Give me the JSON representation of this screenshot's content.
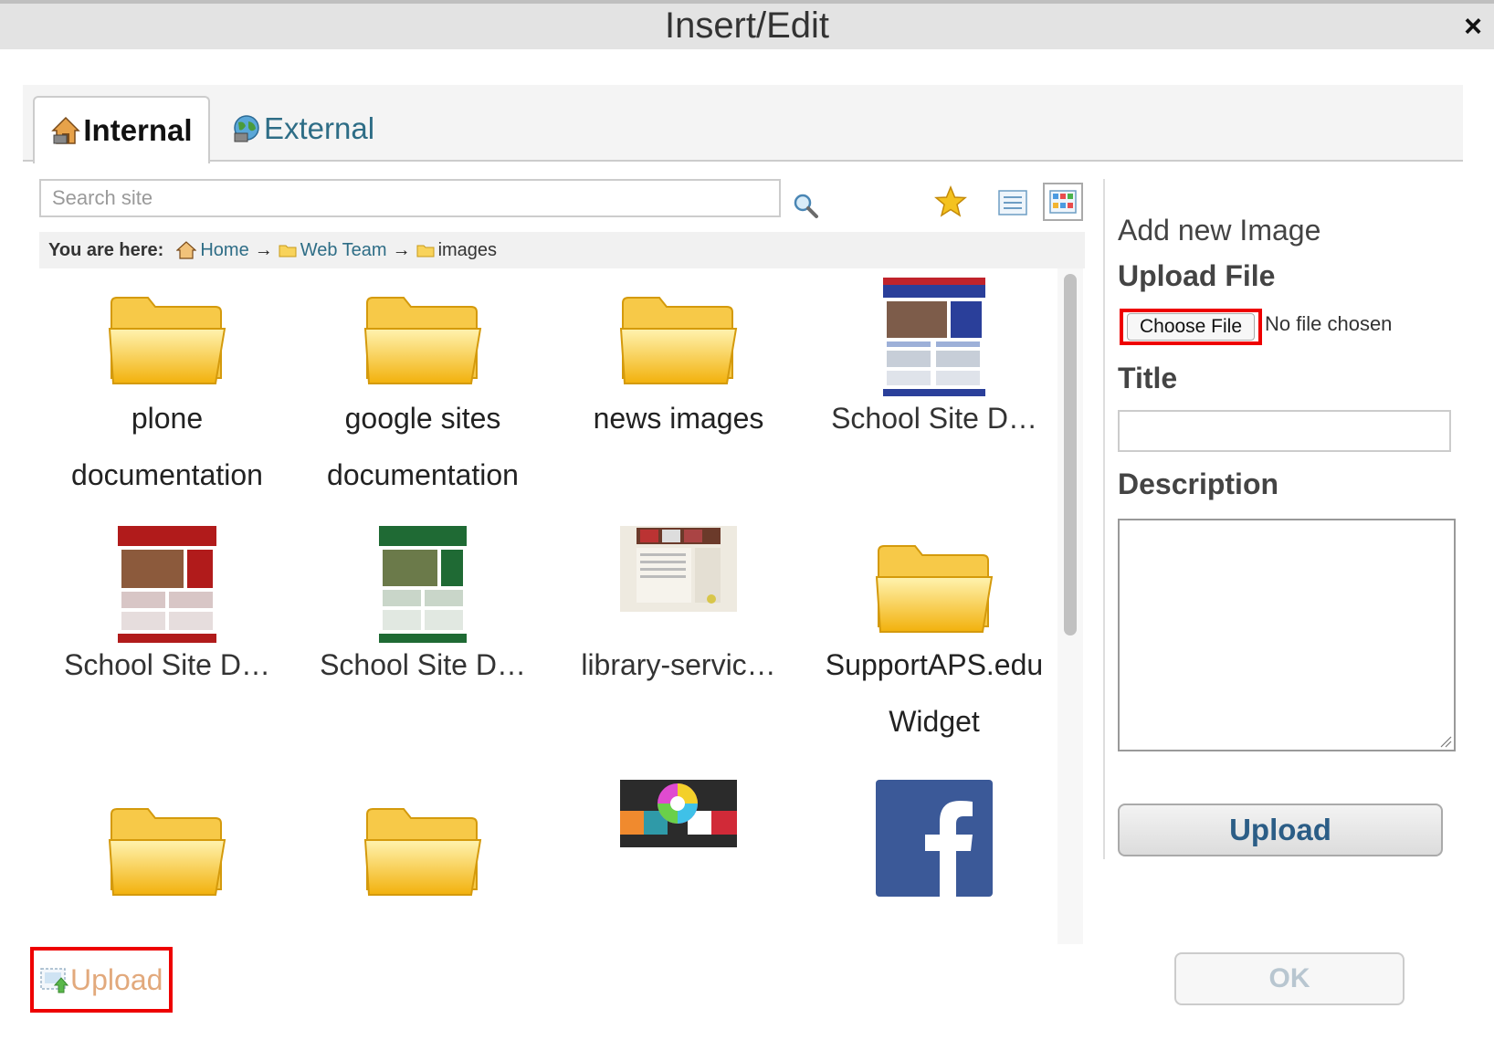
{
  "window": {
    "title": "Insert/Edit",
    "close_symbol": "×"
  },
  "tabs": [
    {
      "label": "Internal",
      "icon": "internal-house-icon",
      "active": true
    },
    {
      "label": "External",
      "icon": "external-globe-icon",
      "active": false
    }
  ],
  "search": {
    "placeholder": "Search site"
  },
  "toolbar": {
    "icons": [
      "search-icon",
      "star-icon",
      "list-view-icon",
      "thumbnail-view-icon"
    ]
  },
  "breadcrumb": {
    "prefix": "You are here:",
    "items": [
      "Home",
      "Web Team",
      "images"
    ],
    "separator": "→"
  },
  "items": [
    {
      "type": "folder",
      "line1": "plone",
      "line2": "documentation"
    },
    {
      "type": "folder",
      "line1": "google sites",
      "line2": "documentation"
    },
    {
      "type": "folder",
      "line1": "news images",
      "line2": ""
    },
    {
      "type": "image",
      "line1": "School Site D…",
      "line2": "",
      "thumb": "blue-site"
    },
    {
      "type": "image",
      "line1": "School Site D…",
      "line2": "",
      "thumb": "red-site"
    },
    {
      "type": "image",
      "line1": "School Site D…",
      "line2": "",
      "thumb": "green-site"
    },
    {
      "type": "image",
      "line1": "library-servic…",
      "line2": "",
      "thumb": "library"
    },
    {
      "type": "folder",
      "line1": "SupportAPS.edu",
      "line2": "Widget"
    },
    {
      "type": "folder",
      "line1": "",
      "line2": ""
    },
    {
      "type": "folder",
      "line1": "",
      "line2": ""
    },
    {
      "type": "image",
      "line1": "",
      "line2": "",
      "thumb": "color-wheel"
    },
    {
      "type": "image",
      "line1": "",
      "line2": "",
      "thumb": "facebook"
    }
  ],
  "panel": {
    "heading": "Add new Image",
    "upload_file_label": "Upload File",
    "choose_file_label": "Choose File",
    "no_file_text": "No file chosen",
    "title_label": "Title",
    "description_label": "Description",
    "upload_button": "Upload"
  },
  "footer": {
    "upload_link": "Upload",
    "ok_button": "OK"
  },
  "colors": {
    "link": "#2e6d86",
    "highlight": "#e00000",
    "upload_text": "#2b5d86"
  }
}
